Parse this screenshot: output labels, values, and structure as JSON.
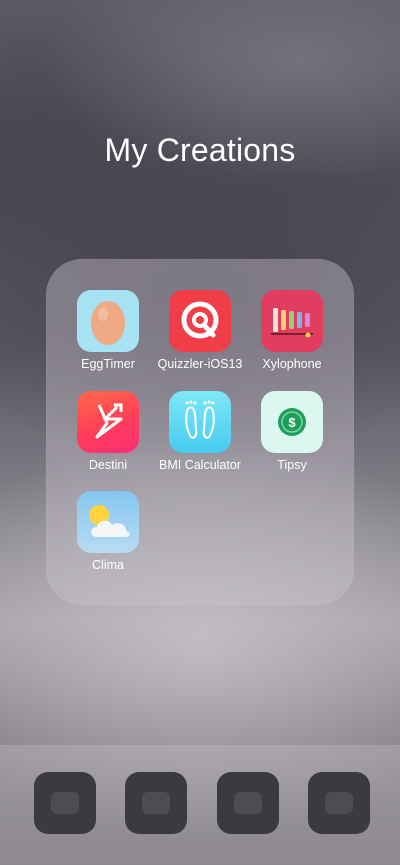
{
  "folder": {
    "title": "My Creations",
    "apps": [
      {
        "label": "EggTimer",
        "icon": "egg-icon"
      },
      {
        "label": "Quizzler-iOS13",
        "icon": "quizzler-icon"
      },
      {
        "label": "Xylophone",
        "icon": "xylophone-icon"
      },
      {
        "label": "Destini",
        "icon": "destini-icon"
      },
      {
        "label": "BMI Calculator",
        "icon": "footprints-icon"
      },
      {
        "label": "Tipsy",
        "icon": "money-icon"
      },
      {
        "label": "Clima",
        "icon": "weather-icon"
      }
    ]
  },
  "dock": {
    "icons": [
      "phone-icon",
      "safari-icon",
      "messages-icon",
      "music-icon"
    ]
  }
}
